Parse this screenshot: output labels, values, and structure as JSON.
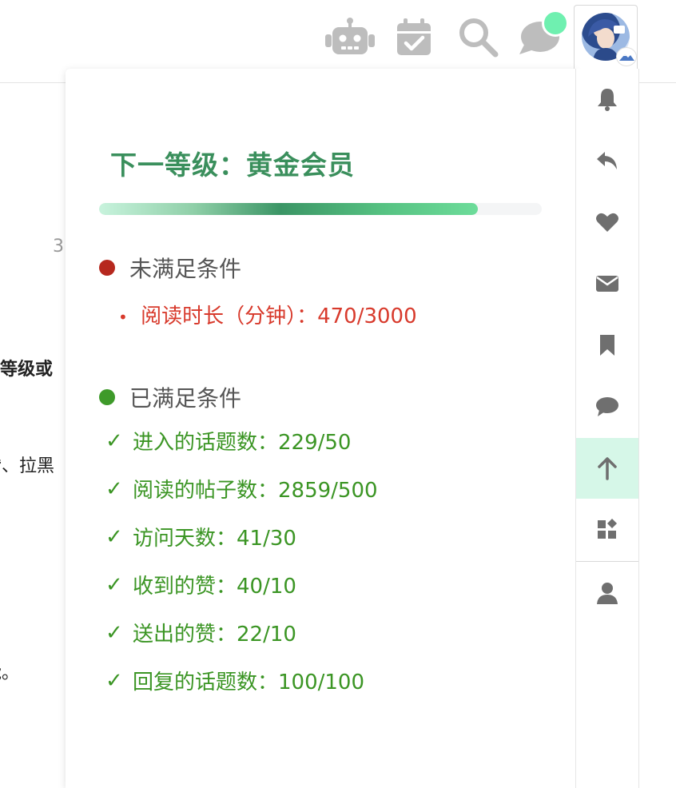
{
  "header": {
    "icons": [
      "robot-icon",
      "calendar-check-icon",
      "search-icon",
      "chat-bubble-icon",
      "avatar"
    ]
  },
  "background_fragments": {
    "number": "3",
    "level_text": "攻等级或",
    "like_text": "赞、拉黑",
    "end_text": "能。"
  },
  "panel": {
    "title": "下一等级：黄金会员",
    "progress": 0.855,
    "unmet": {
      "heading": "未满足条件",
      "items": [
        {
          "bullet": "•",
          "label": "阅读时长（分钟）：470/3000"
        }
      ]
    },
    "met": {
      "heading": "已满足条件",
      "items": [
        {
          "check": "✓",
          "label": "进入的话题数：229/50"
        },
        {
          "check": "✓",
          "label": "阅读的帖子数：2859/500"
        },
        {
          "check": "✓",
          "label": "访问天数：41/30"
        },
        {
          "check": "✓",
          "label": "收到的赞：40/10"
        },
        {
          "check": "✓",
          "label": "送出的赞：22/10"
        },
        {
          "check": "✓",
          "label": "回复的话题数：100/100"
        }
      ]
    }
  },
  "sidebar": {
    "items": [
      "bell-icon",
      "reply-icon",
      "heart-icon",
      "envelope-icon",
      "bookmark-icon",
      "comment-icon",
      "arrow-up-icon",
      "widgets-icon",
      "user-icon"
    ],
    "active_index": 6
  },
  "colors": {
    "accent_green": "#3a8f5c",
    "met_green": "#3b9524",
    "unmet_red": "#d83a2c",
    "active_bg": "#d6f7e8",
    "notification_dot": "#6ff0b0",
    "icon_gray": "#b9b9b9"
  }
}
